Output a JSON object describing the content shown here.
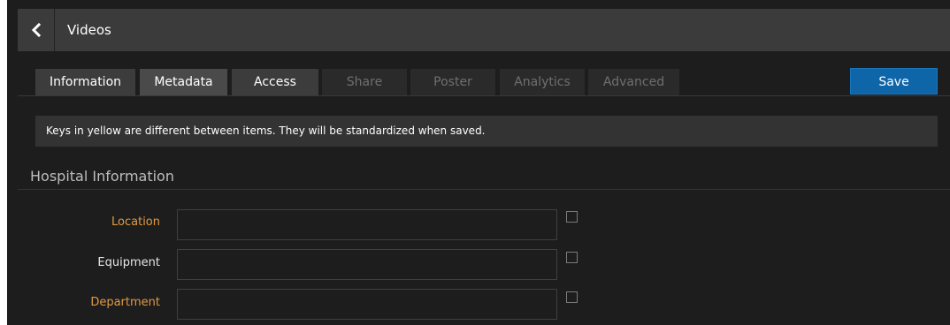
{
  "header": {
    "title": "Videos",
    "back_icon": "chevron-left-icon"
  },
  "tabs": [
    {
      "label": "Information",
      "state": "normal"
    },
    {
      "label": "Metadata",
      "state": "active"
    },
    {
      "label": "Access",
      "state": "normal"
    },
    {
      "label": "Share",
      "state": "disabled"
    },
    {
      "label": "Poster",
      "state": "disabled"
    },
    {
      "label": "Analytics",
      "state": "disabled"
    },
    {
      "label": "Advanced",
      "state": "disabled"
    }
  ],
  "toolbar": {
    "save_label": "Save"
  },
  "notice": "Keys in yellow are different between items. They will be standardized when saved.",
  "section": {
    "title": "Hospital Information",
    "fields": [
      {
        "label": "Location",
        "value": "",
        "differs": true,
        "checked": false
      },
      {
        "label": "Equipment",
        "value": "",
        "differs": false,
        "checked": false
      },
      {
        "label": "Department",
        "value": "",
        "differs": true,
        "checked": false
      }
    ]
  },
  "colors": {
    "accent": "#0e65a8",
    "differs_label": "#e19a42",
    "background": "#1d1d1d"
  }
}
